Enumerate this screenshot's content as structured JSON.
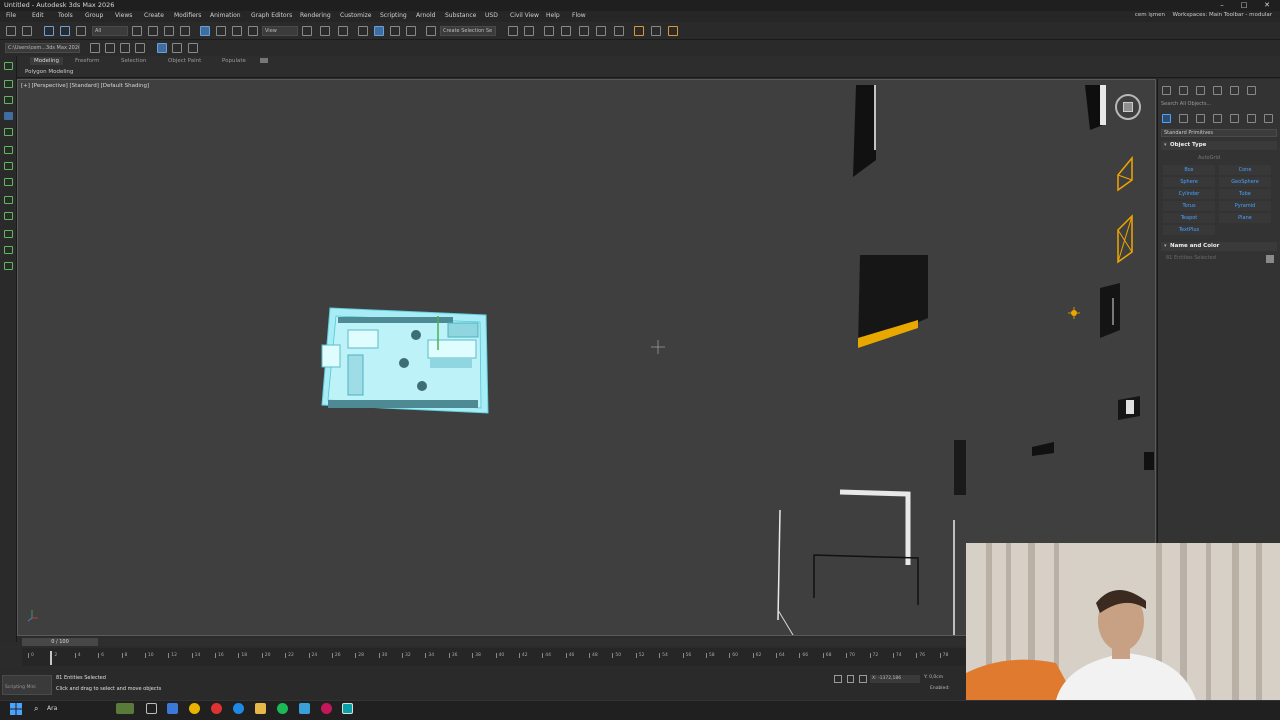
{
  "app": {
    "window_title": "Untitled - Autodesk 3ds Max 2026",
    "user": "cem işmen",
    "workspace": "Workspaces: Main Toolbar - modular"
  },
  "menu": [
    "File",
    "Edit",
    "Tools",
    "Group",
    "Views",
    "Create",
    "Modifiers",
    "Animation",
    "Graph Editors",
    "Rendering",
    "Customize",
    "Scripting",
    "Arnold",
    "Substance",
    "USD",
    "Civil View",
    "Help",
    "Flow"
  ],
  "toolbar": {
    "selection_filter": "All",
    "reference_coord": "View",
    "named_selection": "Create Selection Se"
  },
  "project_path": "C:\\Users\\cem...3ds Max 2026",
  "ribbon": {
    "tabs": [
      "Modeling",
      "Freeform",
      "Selection",
      "Object Paint",
      "Populate"
    ],
    "subtab": "Polygon Modeling"
  },
  "viewport": {
    "label": "[+] [Perspective] [Standard] [Default Shading]"
  },
  "command_panel": {
    "search_placeholder": "Search All Objects...",
    "category": "Standard Primitives",
    "object_type_title": "Object Type",
    "autogrid": "AutoGrid",
    "primitives": [
      "Box",
      "Cone",
      "Sphere",
      "GeoSphere",
      "Cylinder",
      "Tube",
      "Torus",
      "Pyramid",
      "Teapot",
      "Plane",
      "TextPlus"
    ],
    "name_color_title": "Name and Color",
    "name_value": "81 Entities Selected"
  },
  "timeline": {
    "frame_counter": "0 / 100",
    "ticks": [
      0,
      2,
      4,
      6,
      8,
      10,
      12,
      14,
      16,
      18,
      20,
      22,
      24,
      26,
      28,
      30,
      32,
      34,
      36,
      38,
      40,
      42,
      44,
      46,
      48,
      50,
      52,
      54,
      56,
      58,
      60,
      62,
      64,
      66,
      68,
      70,
      72,
      74,
      76,
      78
    ]
  },
  "status": {
    "selected": "81 Entities Selected",
    "prompt": "Click and drag to select and move objects",
    "maxscript": "Scripting Mini",
    "x_coord": "X: -1372,186",
    "y_coord": "Y: 0,0cm",
    "enabled": "Enabled:"
  },
  "taskbar": {
    "search": "Ara"
  },
  "colors": {
    "accent": "#4aa3ff",
    "selection": "#9ee6f2",
    "viewport_bg": "#3f3f3f",
    "gizmo_orange": "#f0a500"
  }
}
